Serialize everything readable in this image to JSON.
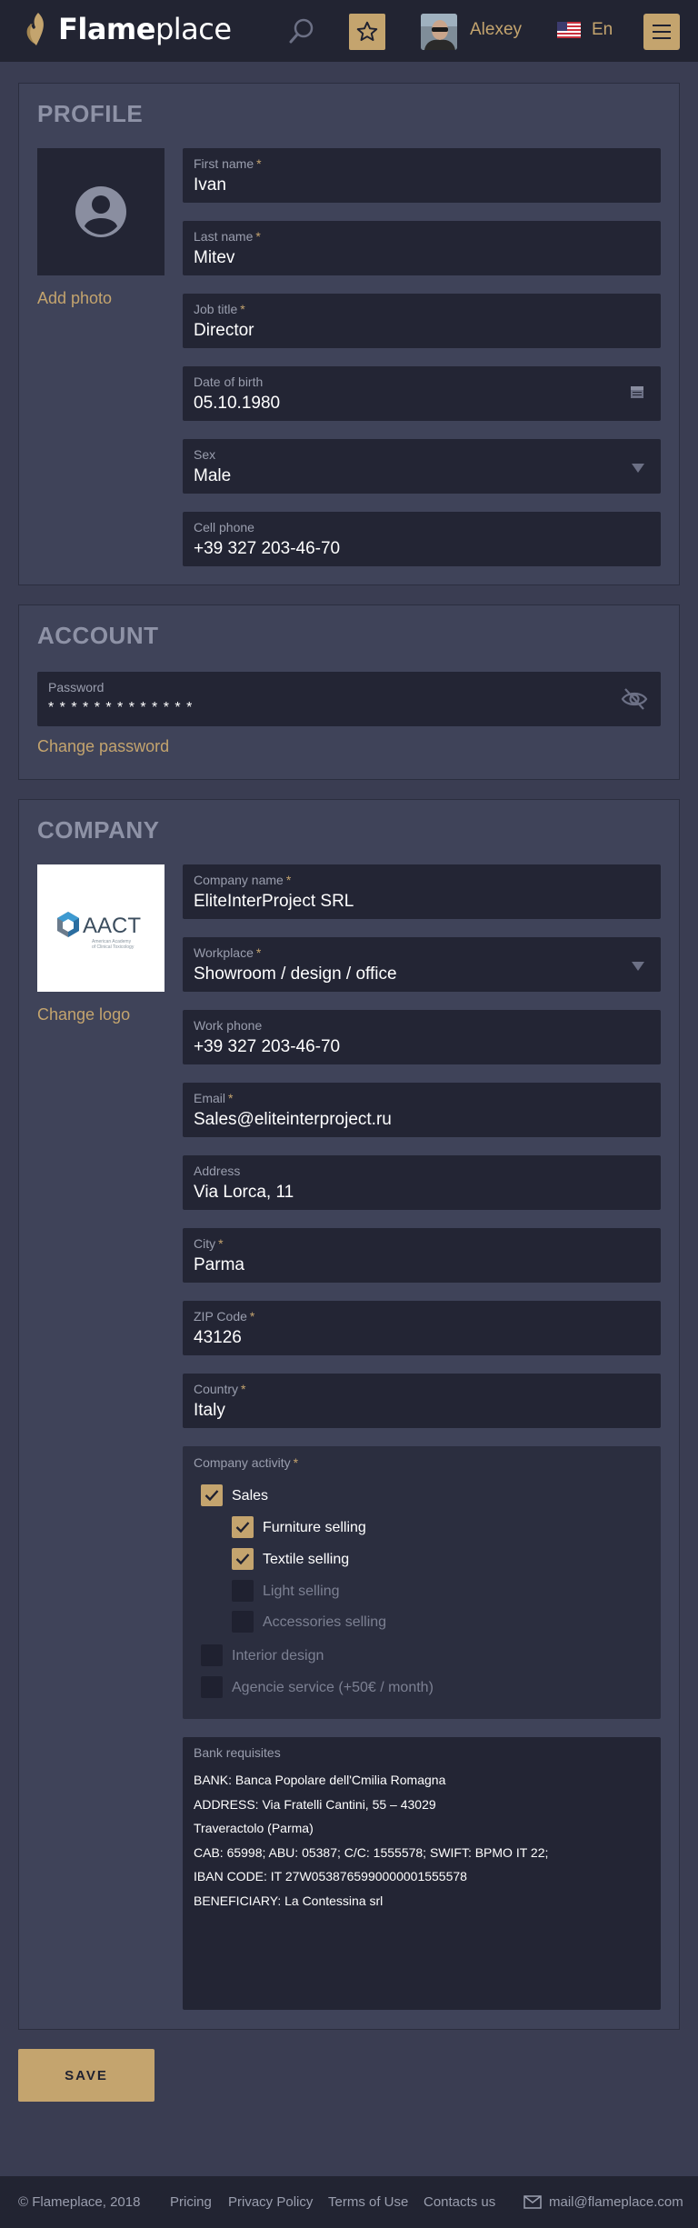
{
  "header": {
    "brand_bold": "Flame",
    "brand_light": "place",
    "user_name": "Alexey",
    "language": "En"
  },
  "profile": {
    "title": "PROFILE",
    "add_photo": "Add photo",
    "fields": {
      "first_name": {
        "label": "First name",
        "required": "*",
        "value": "Ivan"
      },
      "last_name": {
        "label": "Last name",
        "required": "*",
        "value": "Mitev"
      },
      "job_title": {
        "label": "Job title",
        "required": "*",
        "value": "Director"
      },
      "dob": {
        "label": "Date of birth",
        "value": "05.10.1980"
      },
      "sex": {
        "label": "Sex",
        "value": "Male"
      },
      "cell_phone": {
        "label": "Cell phone",
        "value": "+39 327 203-46-70"
      }
    }
  },
  "account": {
    "title": "ACCOUNT",
    "password": {
      "label": "Password",
      "value": "* * * * * * * * * * * * *"
    },
    "change_password": "Change password"
  },
  "company": {
    "title": "COMPANY",
    "logo_text": "AACT",
    "logo_sub1": "American Academy",
    "logo_sub2": "of Clinical Toxicology",
    "change_logo": "Change logo",
    "fields": {
      "company_name": {
        "label": "Company name",
        "required": "*",
        "value": "EliteInterProject SRL"
      },
      "workplace": {
        "label": "Workplace",
        "required": "*",
        "value": "Showroom / design / office"
      },
      "work_phone": {
        "label": "Work phone",
        "value": "+39 327 203-46-70"
      },
      "email": {
        "label": "Email",
        "required": "*",
        "value": "Sales@eliteinterproject.ru"
      },
      "address": {
        "label": "Address",
        "value": "Via Lorca, 11"
      },
      "city": {
        "label": "City",
        "required": "*",
        "value": "Parma"
      },
      "zip": {
        "label": "ZIP Code",
        "required": "*",
        "value": "43126"
      },
      "country": {
        "label": "Country",
        "required": "*",
        "value": "Italy"
      }
    },
    "activity": {
      "label": "Company activity",
      "required": "*",
      "items": [
        {
          "label": "Sales",
          "checked": true
        },
        {
          "label": "Furniture selling",
          "checked": true
        },
        {
          "label": "Textile selling",
          "checked": true
        },
        {
          "label": "Light selling",
          "checked": false
        },
        {
          "label": "Accessories selling",
          "checked": false
        },
        {
          "label": "Interior design",
          "checked": false
        },
        {
          "label": "Agencie service (+50€ / month)",
          "checked": false
        }
      ]
    },
    "bank": {
      "label": "Bank requisites",
      "lines": [
        "BANK: Banca Popolare dell'Cmilia Romagna",
        "ADDRESS: Via Fratelli Cantini, 55 – 43029",
        "Traveractolo (Parma)",
        "CAB: 65998; ABU: 05387; C/C: 1555578; SWIFT: BPMO IT 22;",
        "IBAN CODE: IT 27W0538765990000001555578",
        "BENEFICIARY: La Contessina srl"
      ]
    }
  },
  "save_label": "SAVE",
  "footer": {
    "copyright": "© Flameplace, 2018",
    "links": [
      "Pricing",
      "Privacy Policy",
      "Terms of Use",
      "Contacts us"
    ],
    "email": "mail@flameplace.com"
  },
  "colors": {
    "accent": "#c4a46e",
    "header_bg": "#222432",
    "page_bg": "#3a3d52",
    "field_bg": "#232534"
  }
}
